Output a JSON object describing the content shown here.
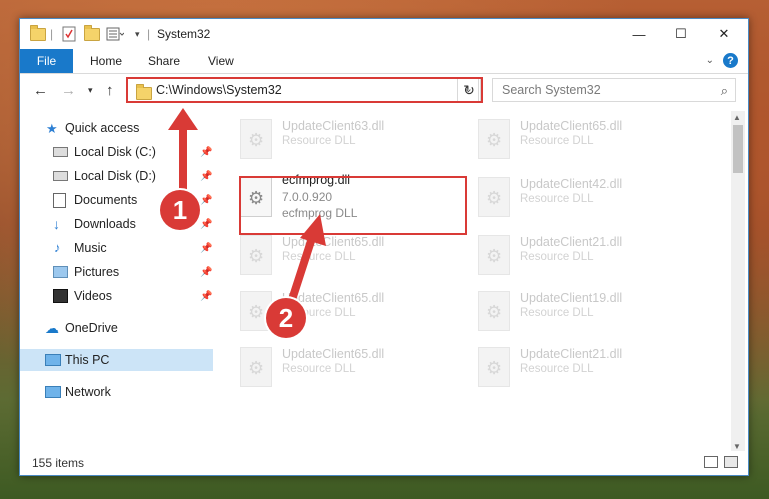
{
  "window": {
    "title": "System32",
    "controls": {
      "minimize": "—",
      "maximize": "☐",
      "close": "✕"
    }
  },
  "ribbon": {
    "tabs": [
      {
        "label": "File"
      },
      {
        "label": "Home"
      },
      {
        "label": "Share"
      },
      {
        "label": "View"
      }
    ],
    "help": "?"
  },
  "navbar": {
    "address": "C:\\Windows\\System32",
    "search_placeholder": "Search System32"
  },
  "sidebar": {
    "items": [
      {
        "label": "Quick access",
        "icon": "star-icon",
        "pinned": false
      },
      {
        "label": "Local Disk (C:)",
        "icon": "drive-icon",
        "pinned": true
      },
      {
        "label": "Local Disk (D:)",
        "icon": "drive-icon",
        "pinned": true
      },
      {
        "label": "Documents",
        "icon": "documents-icon",
        "pinned": true
      },
      {
        "label": "Downloads",
        "icon": "downloads-icon",
        "pinned": true
      },
      {
        "label": "Music",
        "icon": "music-icon",
        "pinned": true
      },
      {
        "label": "Pictures",
        "icon": "pictures-icon",
        "pinned": true
      },
      {
        "label": "Videos",
        "icon": "videos-icon",
        "pinned": true
      },
      {
        "label": "OneDrive",
        "icon": "cloud-icon",
        "pinned": false
      },
      {
        "label": "This PC",
        "icon": "computer-icon",
        "pinned": false,
        "selected": true
      },
      {
        "label": "Network",
        "icon": "network-icon",
        "pinned": false
      }
    ]
  },
  "files": {
    "highlighted": {
      "name": "ecfmprog.dll",
      "version": "7.0.0.920",
      "description": "ecfmprog DLL"
    },
    "background_items": [
      {
        "name": "UpdateClient63.dll",
        "type": "Resource DLL"
      },
      {
        "name": "UpdateClient65.dll",
        "type": "Resource DLL"
      },
      {
        "name": "UpdateClient42.dll",
        "type": "Resource DLL"
      },
      {
        "name": "UpdateClient65.dll",
        "type": "Resource DLL"
      },
      {
        "name": "UpdateClient21.dll",
        "type": "Resource DLL"
      },
      {
        "name": "UpdateClient65.dll",
        "type": "Resource DLL"
      },
      {
        "name": "UpdateClient19.dll",
        "type": "Resource DLL"
      },
      {
        "name": "UpdateClient65.dll",
        "type": "Resource DLL"
      },
      {
        "name": "UpdateClient21.dll",
        "type": "Resource DLL"
      }
    ]
  },
  "status": {
    "item_count": "155 items"
  },
  "annotations": {
    "step1": "1",
    "step2": "2",
    "color": "#d93a36"
  },
  "colors": {
    "accent": "#1979ca",
    "selection": "#cce4f7"
  }
}
